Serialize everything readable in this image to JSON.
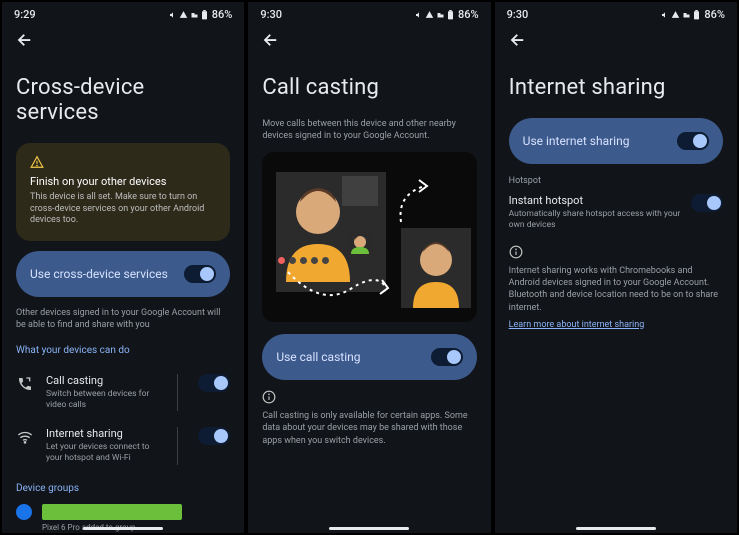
{
  "status": {
    "time1": "9:29",
    "time2": "9:30",
    "time3": "9:30",
    "battery": "86%"
  },
  "screen1": {
    "title": "Cross-device services",
    "warning": {
      "title": "Finish on your other devices",
      "body": "This device is all set. Make sure to turn on cross-device services on your other Android devices too."
    },
    "main_toggle_label": "Use cross-device services",
    "helper": "Other devices signed in to your Google Account will be able to find and share with you",
    "section_label": "What your devices can do",
    "feature1": {
      "title": "Call casting",
      "sub": "Switch between devices for video calls"
    },
    "feature2": {
      "title": "Internet sharing",
      "sub": "Let your devices connect to your hotspot and Wi-Fi"
    },
    "groups_label": "Device groups",
    "group_sub": "Pixel 6 Pro added to group"
  },
  "screen2": {
    "title": "Call casting",
    "subtitle": "Move calls between this device and other nearby devices signed in to your Google Account.",
    "main_toggle_label": "Use call casting",
    "helper": "Call casting is only available for certain apps. Some data about your devices may be shared with those apps when you switch devices."
  },
  "screen3": {
    "title": "Internet sharing",
    "main_toggle_label": "Use internet sharing",
    "hotspot_section": "Hotspot",
    "hotspot": {
      "title": "Instant hotspot",
      "sub": "Automatically share hotspot access with your own devices"
    },
    "info": "Internet sharing works with Chromebooks and Android devices signed in to your Google Account. Bluetooth and device location need to be on to share internet.",
    "link": "Learn more about internet sharing"
  }
}
